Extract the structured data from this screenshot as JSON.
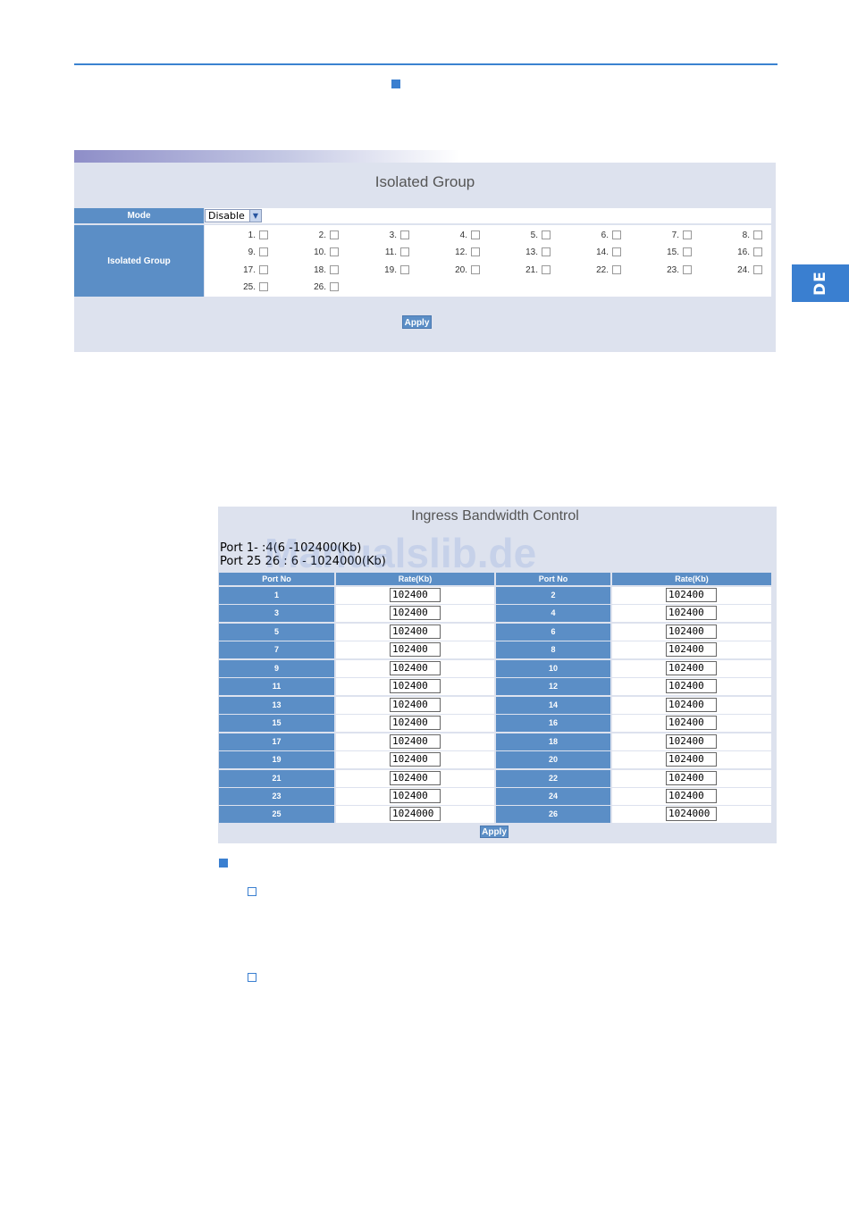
{
  "side_tab": {
    "label": "DE"
  },
  "isolated_group": {
    "title": "Isolated Group",
    "mode_label": "Mode",
    "mode_value": "Disable",
    "group_label": "Isolated Group",
    "ports": [
      "1.",
      "2.",
      "3.",
      "4.",
      "5.",
      "6.",
      "7.",
      "8.",
      "9.",
      "10.",
      "11.",
      "12.",
      "13.",
      "14.",
      "15.",
      "16.",
      "17.",
      "18.",
      "19.",
      "20.",
      "21.",
      "22.",
      "23.",
      "24.",
      "25.",
      "26."
    ],
    "apply_label": "Apply"
  },
  "ingress": {
    "title": "Ingress Bandwidth Control",
    "note_line1": "Port 1- :4(6 -102400(Kb)",
    "note_line2": "Port 25 26 : 6 - 1024000(Kb)",
    "watermark": "Manualslib.de",
    "col_port": "Port No",
    "col_rate": "Rate(Kb)",
    "rows": [
      {
        "left_port": "1",
        "left_rate": "102400",
        "right_port": "2",
        "right_rate": "102400"
      },
      {
        "left_port": "3",
        "left_rate": "102400",
        "right_port": "4",
        "right_rate": "102400"
      },
      {
        "left_port": "5",
        "left_rate": "102400",
        "right_port": "6",
        "right_rate": "102400"
      },
      {
        "left_port": "7",
        "left_rate": "102400",
        "right_port": "8",
        "right_rate": "102400"
      },
      {
        "left_port": "9",
        "left_rate": "102400",
        "right_port": "10",
        "right_rate": "102400"
      },
      {
        "left_port": "11",
        "left_rate": "102400",
        "right_port": "12",
        "right_rate": "102400"
      },
      {
        "left_port": "13",
        "left_rate": "102400",
        "right_port": "14",
        "right_rate": "102400"
      },
      {
        "left_port": "15",
        "left_rate": "102400",
        "right_port": "16",
        "right_rate": "102400"
      },
      {
        "left_port": "17",
        "left_rate": "102400",
        "right_port": "18",
        "right_rate": "102400"
      },
      {
        "left_port": "19",
        "left_rate": "102400",
        "right_port": "20",
        "right_rate": "102400"
      },
      {
        "left_port": "21",
        "left_rate": "102400",
        "right_port": "22",
        "right_rate": "102400"
      },
      {
        "left_port": "23",
        "left_rate": "102400",
        "right_port": "24",
        "right_rate": "102400"
      },
      {
        "left_port": "25",
        "left_rate": "1024000",
        "right_port": "26",
        "right_rate": "1024000"
      }
    ],
    "apply_label": "Apply"
  },
  "colors": {
    "accent": "#3a7fd0",
    "header_blue": "#5b8ec6",
    "panel": "#dde2ee"
  }
}
